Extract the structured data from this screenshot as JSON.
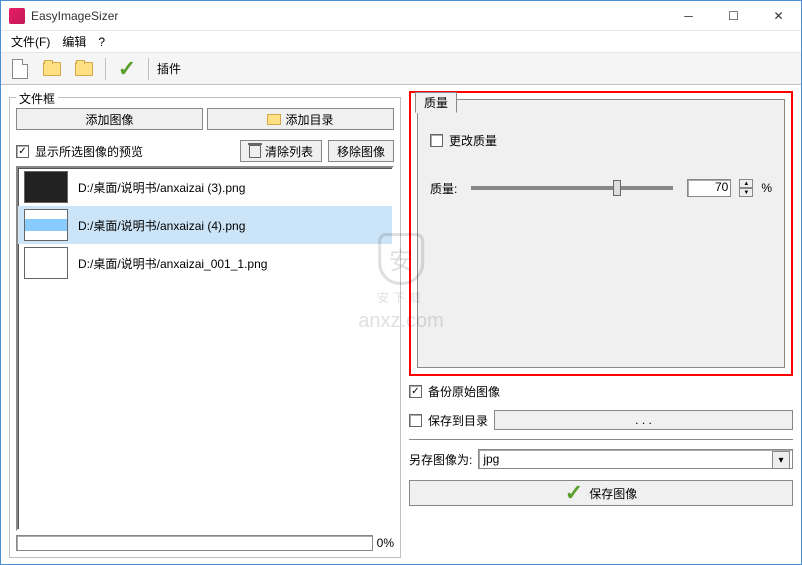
{
  "title": "EasyImageSizer",
  "menu": {
    "file": "文件(F)",
    "edit": "编辑",
    "help": "?"
  },
  "toolbar": {
    "plugin": "插件"
  },
  "left": {
    "legend": "文件框",
    "add_image": "添加图像",
    "add_folder": "添加目录",
    "preview": "显示所选图像的预览",
    "clear_list": "清除列表",
    "remove_image": "移除图像",
    "files": [
      "D:/桌面/说明书/anxaizai (3).png",
      "D:/桌面/说明书/anxaizai (4).png",
      "D:/桌面/说明书/anxaizai_001_1.png"
    ],
    "progress": "0%"
  },
  "right": {
    "quality_tab": "质量",
    "change_quality": "更改质量",
    "quality_label": "质量:",
    "quality_value": "70",
    "quality_unit": "%",
    "backup": "备份原始图像",
    "save_dir": "保存到目录",
    "dots": ". . .",
    "save_as": "另存图像为:",
    "format": "jpg",
    "save_btn": "保存图像"
  },
  "watermark": {
    "text": "安下载",
    "domain": "anxz.com"
  }
}
